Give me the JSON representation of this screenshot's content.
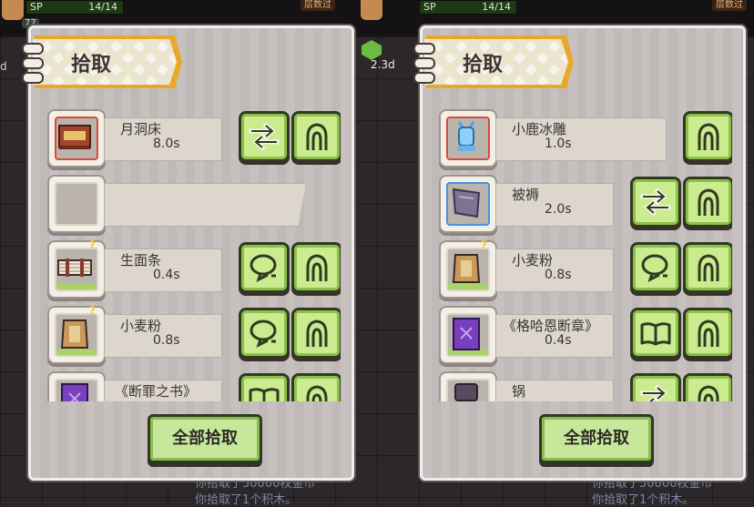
{
  "hud": {
    "left": {
      "sp_label": "SP",
      "sp_value": "14/14",
      "button": "层数过",
      "level": "77",
      "side_text": "d"
    },
    "right": {
      "sp_label": "SP",
      "sp_value": "14/14",
      "button": "层数过",
      "buff_time": "2.3d"
    }
  },
  "messages": {
    "left": [
      "你拾取了50000枚金币",
      "你拾取了1个积木。"
    ],
    "right": [
      "你拾取了50000枚金币",
      "你拾取了1个积木。"
    ]
  },
  "panels": [
    {
      "title": "拾取",
      "items": [
        {
          "name": "月洞床",
          "time": "8.0s",
          "buttons": [
            "swap-icon",
            "hand-icon"
          ],
          "icon": "bed-icon"
        },
        {
          "name": "",
          "time": "",
          "buttons": [],
          "icon": "empty-slot"
        },
        {
          "name": "生面条",
          "time": "0.4s",
          "buttons": [
            "bubble-icon",
            "hand-icon"
          ],
          "icon": "noodles-icon"
        },
        {
          "name": "小麦粉",
          "time": "0.8s",
          "buttons": [
            "bubble-icon",
            "hand-icon"
          ],
          "icon": "flour-icon"
        },
        {
          "name": "《断罪之书》",
          "time": "",
          "buttons": [
            "book-icon",
            "hand-icon"
          ],
          "icon": "purple-book-icon"
        }
      ],
      "pick_all": "全部拾取"
    },
    {
      "title": "拾取",
      "items": [
        {
          "name": "小鹿冰雕",
          "time": "1.0s",
          "buttons": [
            "hand-icon"
          ],
          "icon": "ice-deer-icon"
        },
        {
          "name": "被褥",
          "time": "2.0s",
          "buttons": [
            "swap-icon",
            "hand-icon"
          ],
          "icon": "bedding-icon"
        },
        {
          "name": "小麦粉",
          "time": "0.8s",
          "buttons": [
            "bubble-icon",
            "hand-icon"
          ],
          "icon": "flour-icon"
        },
        {
          "name": "《格哈恩断章》",
          "time": "0.4s",
          "buttons": [
            "book-icon",
            "hand-icon"
          ],
          "icon": "purple-book-icon"
        },
        {
          "name": "锅",
          "time": "",
          "buttons": [
            "swap-icon",
            "hand-icon"
          ],
          "icon": "pot-icon"
        }
      ],
      "pick_all": "全部拾取"
    }
  ],
  "colors": {
    "button_fill": "#caec8e",
    "button_border": "#2f3a21",
    "title_edge": "#e8a92b",
    "panel_bg": "#c4bebd"
  }
}
